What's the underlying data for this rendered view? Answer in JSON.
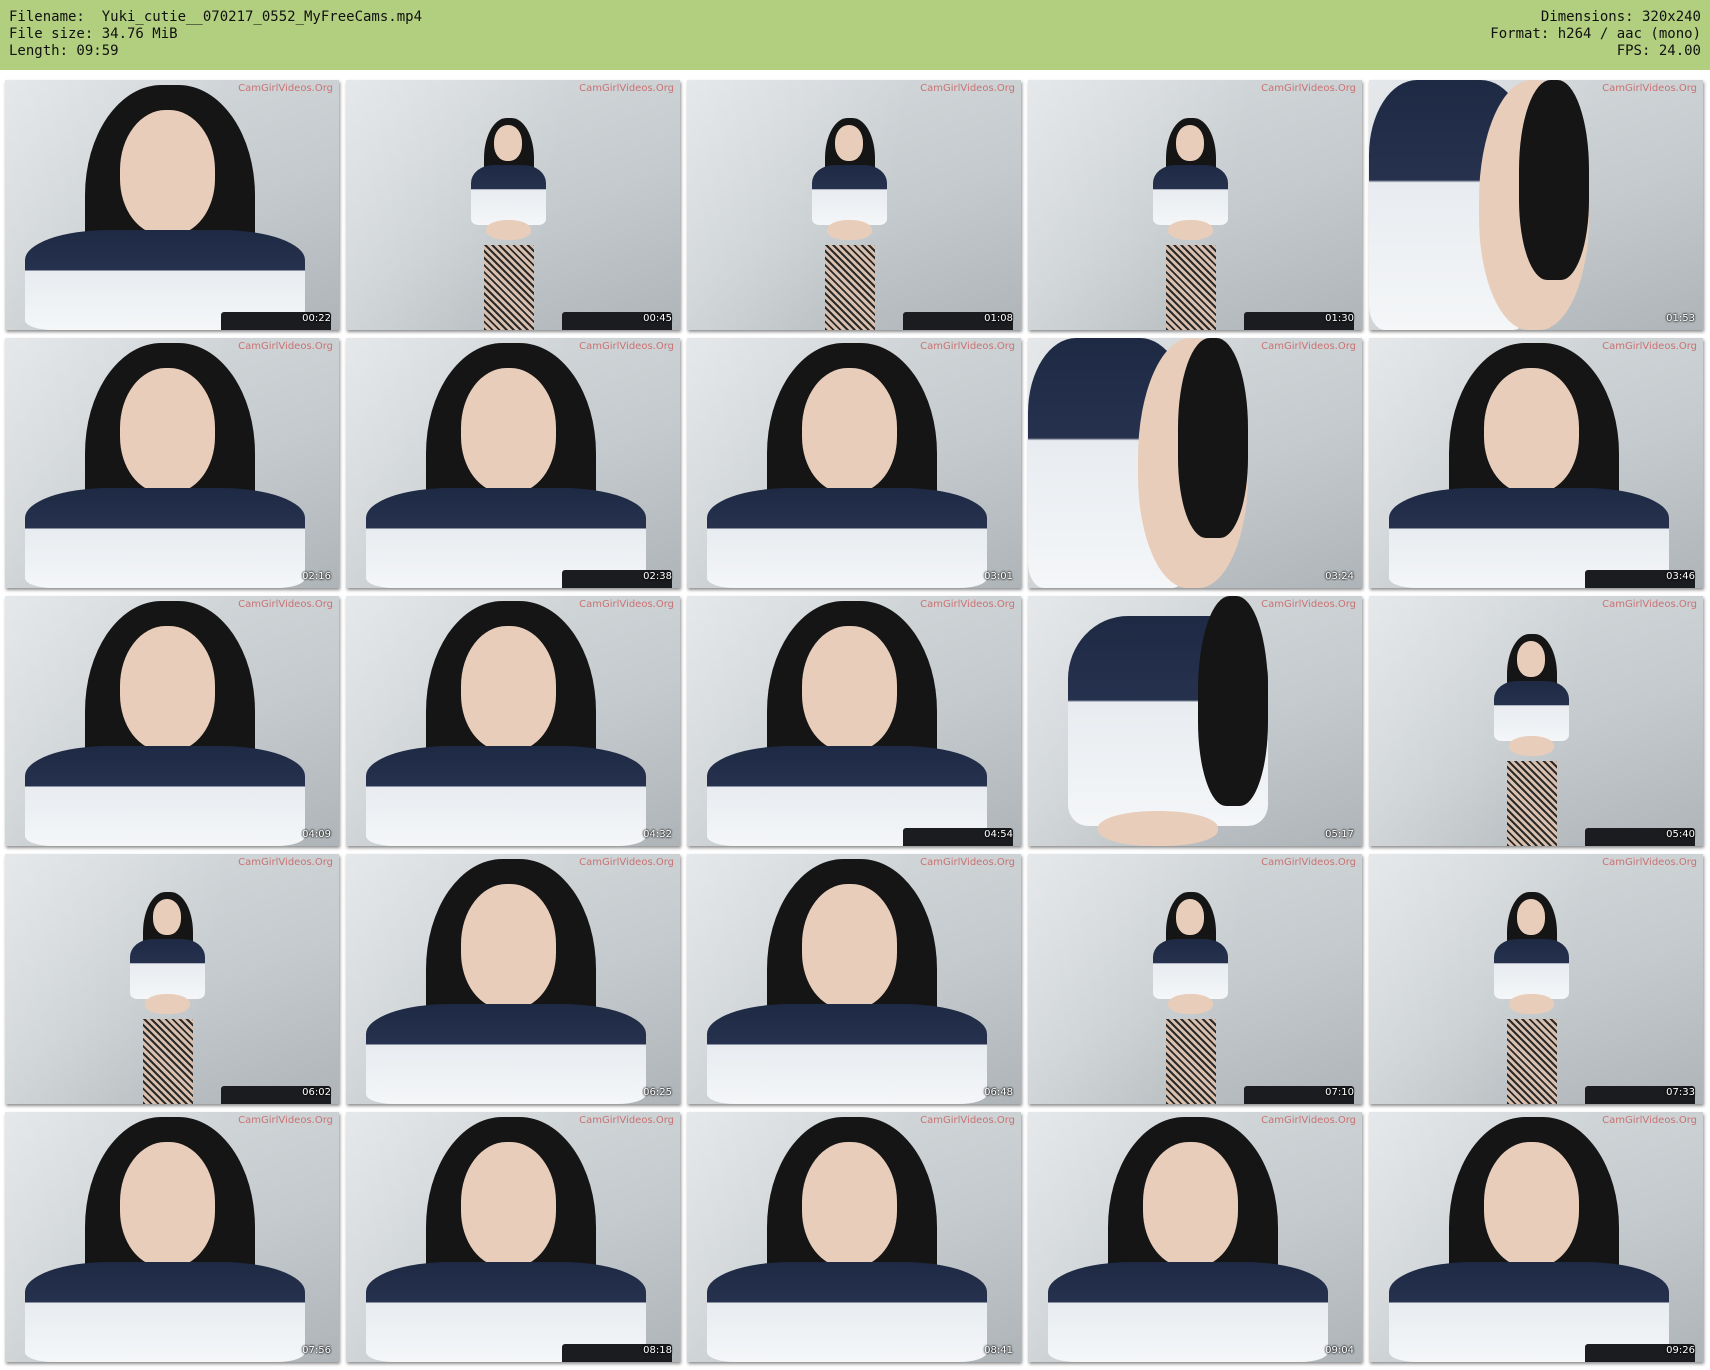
{
  "header": {
    "filename": "Filename:  Yuki_cutie__070217_0552_MyFreeCams.mp4",
    "filesize": "File size: 34.76 MiB",
    "length": "Length: 09:59",
    "dimensions": "Dimensions: 320x240",
    "format": "Format: h264 / aac (mono)",
    "fps": "FPS: 24.00"
  },
  "watermark": "CamGirlVideos.Org",
  "thumbnails": [
    {
      "time": "00:22",
      "shot": "close"
    },
    {
      "time": "00:45",
      "shot": "full"
    },
    {
      "time": "01:08",
      "shot": "full"
    },
    {
      "time": "01:30",
      "shot": "full"
    },
    {
      "time": "01:53",
      "shot": "arm"
    },
    {
      "time": "02:16",
      "shot": "close"
    },
    {
      "time": "02:38",
      "shot": "close"
    },
    {
      "time": "03:01",
      "shot": "close"
    },
    {
      "time": "03:24",
      "shot": "arm"
    },
    {
      "time": "03:46",
      "shot": "close"
    },
    {
      "time": "04:09",
      "shot": "close"
    },
    {
      "time": "04:32",
      "shot": "close"
    },
    {
      "time": "04:54",
      "shot": "close"
    },
    {
      "time": "05:17",
      "shot": "torso"
    },
    {
      "time": "05:40",
      "shot": "full"
    },
    {
      "time": "06:02",
      "shot": "full"
    },
    {
      "time": "06:25",
      "shot": "close"
    },
    {
      "time": "06:48",
      "shot": "close"
    },
    {
      "time": "07:10",
      "shot": "full"
    },
    {
      "time": "07:33",
      "shot": "full"
    },
    {
      "time": "07:56",
      "shot": "close"
    },
    {
      "time": "08:18",
      "shot": "close"
    },
    {
      "time": "08:41",
      "shot": "close"
    },
    {
      "time": "09:04",
      "shot": "close"
    },
    {
      "time": "09:26",
      "shot": "close"
    }
  ]
}
